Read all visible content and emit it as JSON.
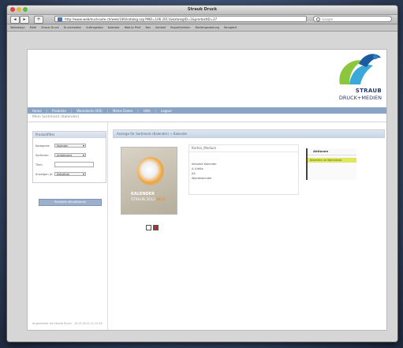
{
  "window": {
    "title": "Straub Druck"
  },
  "toolbar": {
    "back": "◂",
    "forward": "▸",
    "add": "+",
    "url": "http://www.webdrucksuite.ch/web/106/katalog.asp?MID=106.2011&katalogID=1&produktID=37",
    "search_placeholder": "Google"
  },
  "bookmarks": [
    "Webdesign",
    "Mitte",
    "Straub Druck",
    "Druckmedien",
    "Auftragsliste",
    "Kalender",
    "Web to Print",
    "Neu",
    "Kontakt",
    "Reportfunktion",
    "Mediengestaltung",
    "Neuigkeit"
  ],
  "site": {
    "logo_line1": "STRAUB",
    "logo_line2": "DRUCK+MEDIEN",
    "nav": [
      "Home",
      "Produkte",
      "Warenkorb (0/0)",
      "Meine Daten",
      "Hilfe",
      "Logout"
    ],
    "breadcrumb": "Mein Sortiment (Kalender)"
  },
  "filter": {
    "title": "Produktfilter",
    "rows": [
      {
        "label": "Kategorie:",
        "type": "select",
        "value": "Kalender"
      },
      {
        "label": "Sortieren:",
        "type": "select",
        "value": "Artikelname"
      },
      {
        "label": "Titel:",
        "type": "input",
        "value": ""
      },
      {
        "label": "Anzeigen je:",
        "type": "select",
        "value": "Detailliste"
      }
    ],
    "button": "Produkte aktualisieren"
  },
  "results": {
    "header": "Anzeige für Sortiment (Kalender) ➝ Kalender",
    "product": {
      "image_title": "KALENDER",
      "image_subtitle": "STRAUB 2012",
      "image_badge": "2012",
      "info_title": "Karten_Medium",
      "info_lines": [
        "Aktuelle Kalender",
        "A-Größe",
        "A4",
        "Wandkalender"
      ],
      "actions_title": "Aktionen",
      "action_item": "Bestellen im Warenkorb"
    }
  },
  "footer": "Angemeldet als Straub Druck · 10.07.2012 11:12:55",
  "colors": {
    "nav": "#8aa4c6",
    "highlight": "#dfe85a"
  }
}
